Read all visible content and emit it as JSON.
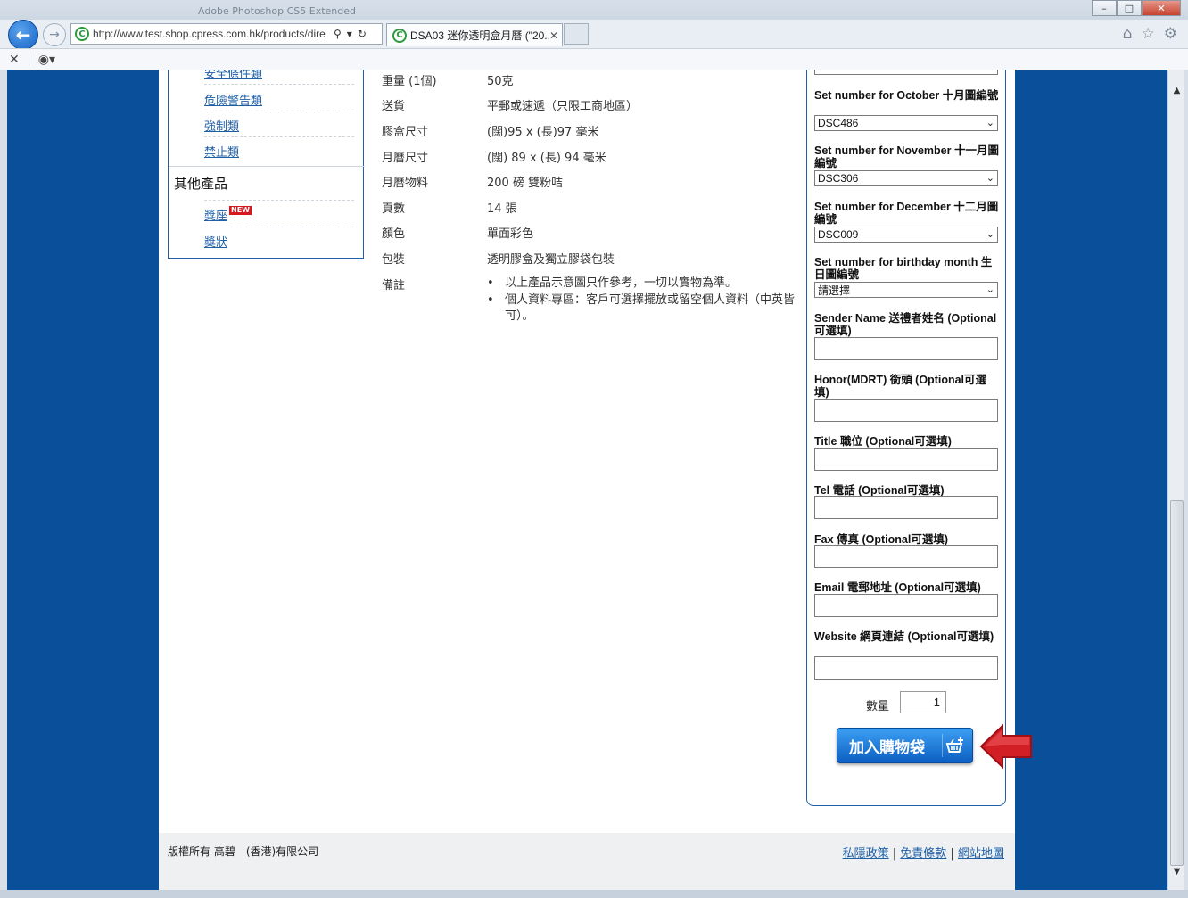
{
  "browser": {
    "bg_tab_ghost": "Adobe Photoshop CS5 Extended",
    "url": "http://www.test.shop.cpress.com.hk/products/dire",
    "tab_title": "DSA03 迷你透明盒月曆 (\"20...",
    "favicon_letter": "C"
  },
  "sidebar": {
    "links_top": [
      {
        "label": "安全條件類"
      },
      {
        "label": "危險警告類"
      },
      {
        "label": "強制類"
      },
      {
        "label": "禁止類"
      }
    ],
    "heading": "其他產品",
    "links_other": [
      {
        "label": "獎座",
        "badge": "NEW"
      },
      {
        "label": "獎狀"
      }
    ]
  },
  "spec": {
    "rows": [
      {
        "label": "重量 (1個)",
        "value": "50克"
      },
      {
        "label": "送貨",
        "value": "平郵或速遞（只限工商地區）"
      },
      {
        "label": "膠盒尺寸",
        "value": "(闊)95 x (長)97 毫米"
      },
      {
        "label": "月曆尺寸",
        "value": "(闊) 89 x (長) 94 毫米"
      },
      {
        "label": "月曆物料",
        "value": "200 磅 雙粉咭"
      },
      {
        "label": "頁數",
        "value": "14 張"
      },
      {
        "label": "顏色",
        "value": "單面彩色"
      },
      {
        "label": "包裝",
        "value": "透明膠盒及獨立膠袋包裝"
      }
    ],
    "notes_label": "備註",
    "notes": [
      "以上產品示意圖只作參考，一切以實物為準。",
      "個人資料專區：客戶可選擇擺放或留空個人資料（中英皆可）。"
    ]
  },
  "form": {
    "selects": [
      {
        "label": "Set number for October 十月圖編號",
        "value": "DSC486"
      },
      {
        "label": "Set number for November 十一月圖編號",
        "value": "DSC306"
      },
      {
        "label": "Set number for December 十二月圖編號",
        "value": "DSC009"
      },
      {
        "label": "Set number for birthday month 生日圖編號",
        "value": "請選擇"
      }
    ],
    "inputs": [
      {
        "label": "Sender Name 送禮者姓名 (Optional可選填)",
        "value": ""
      },
      {
        "label": "Honor(MDRT) 銜頭 (Optional可選填)",
        "value": ""
      },
      {
        "label": "Title 職位 (Optional可選填)",
        "value": ""
      },
      {
        "label": "Tel 電話 (Optional可選填)",
        "value": ""
      },
      {
        "label": "Fax 傳真 (Optional可選填)",
        "value": ""
      },
      {
        "label": "Email 電郵地址 (Optional可選填)",
        "value": ""
      },
      {
        "label": "Website 網頁連結 (Optional可選填)",
        "value": ""
      }
    ],
    "quantity_label": "數量",
    "quantity_value": "1",
    "add_to_cart_label": "加入購物袋",
    "arrow_color": "#d21f26"
  },
  "footer": {
    "copyright": "版權所有 高碧　(香港)有限公司",
    "links": [
      {
        "label": "私隱政策"
      },
      {
        "label": "免責條款"
      },
      {
        "label": "網站地圖"
      }
    ]
  },
  "colors": {
    "viewport_bg": "#0a4f9a",
    "accent_blue": "#1f5fa6",
    "button_blue": "#0d5fc1"
  }
}
